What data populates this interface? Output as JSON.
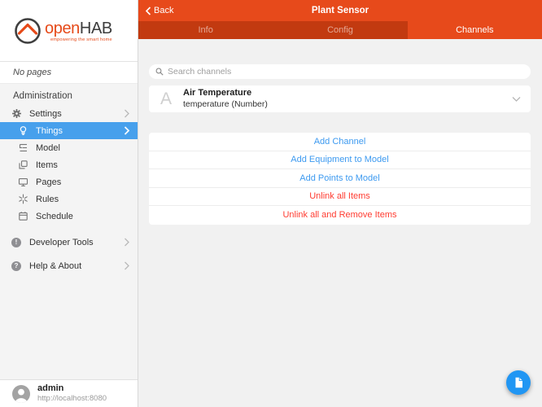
{
  "colors": {
    "accent_orange": "#e74a1b",
    "tabbar_dark_orange": "#c23a10",
    "selected_blue": "#47a0ec",
    "link_blue": "#3d9af0",
    "danger_red": "#ff3b30",
    "fab_blue": "#2196f3",
    "content_bg": "#f1f1f1",
    "sidebar_bg": "#f4f4f4"
  },
  "sidebar": {
    "logo": {
      "brand_open": "open",
      "brand_hab": "HAB",
      "tagline": "empowering the smart home"
    },
    "no_pages": "No pages",
    "section_label": "Administration",
    "items": [
      {
        "label": "Settings",
        "icon": "gear-icon",
        "chevron": true,
        "selected": false
      },
      {
        "label": "Things",
        "icon": "lightbulb-icon",
        "chevron": true,
        "selected": true
      },
      {
        "label": "Model",
        "icon": "model-tree-icon",
        "chevron": false,
        "selected": false
      },
      {
        "label": "Items",
        "icon": "copy-icon",
        "chevron": false,
        "selected": false
      },
      {
        "label": "Pages",
        "icon": "monitor-icon",
        "chevron": false,
        "selected": false
      },
      {
        "label": "Rules",
        "icon": "spark-icon",
        "chevron": false,
        "selected": false
      },
      {
        "label": "Schedule",
        "icon": "calendar-icon",
        "chevron": false,
        "selected": false
      },
      {
        "label": "Developer Tools",
        "icon": "circle-exclamation-icon",
        "chevron": true,
        "selected": false
      },
      {
        "label": "Help & About",
        "icon": "circle-question-icon",
        "chevron": true,
        "selected": false
      }
    ],
    "user": {
      "name": "admin",
      "url": "http://localhost:8080"
    }
  },
  "header": {
    "back_label": "Back",
    "title": "Plant Sensor"
  },
  "tabs": [
    {
      "label": "Info",
      "active": false
    },
    {
      "label": "Config",
      "active": false
    },
    {
      "label": "Channels",
      "active": true
    }
  ],
  "search": {
    "placeholder": "Search channels"
  },
  "channel": {
    "initial": "A",
    "title": "Air Temperature",
    "subtitle": "temperature (Number)"
  },
  "actions": [
    {
      "label": "Add Channel",
      "type": "primary"
    },
    {
      "label": "Add Equipment to Model",
      "type": "primary"
    },
    {
      "label": "Add Points to Model",
      "type": "primary"
    },
    {
      "label": "Unlink all Items",
      "type": "danger"
    },
    {
      "label": "Unlink all and Remove Items",
      "type": "danger"
    }
  ],
  "icons": {
    "devtools_glyph": "!",
    "help_glyph": "?"
  }
}
